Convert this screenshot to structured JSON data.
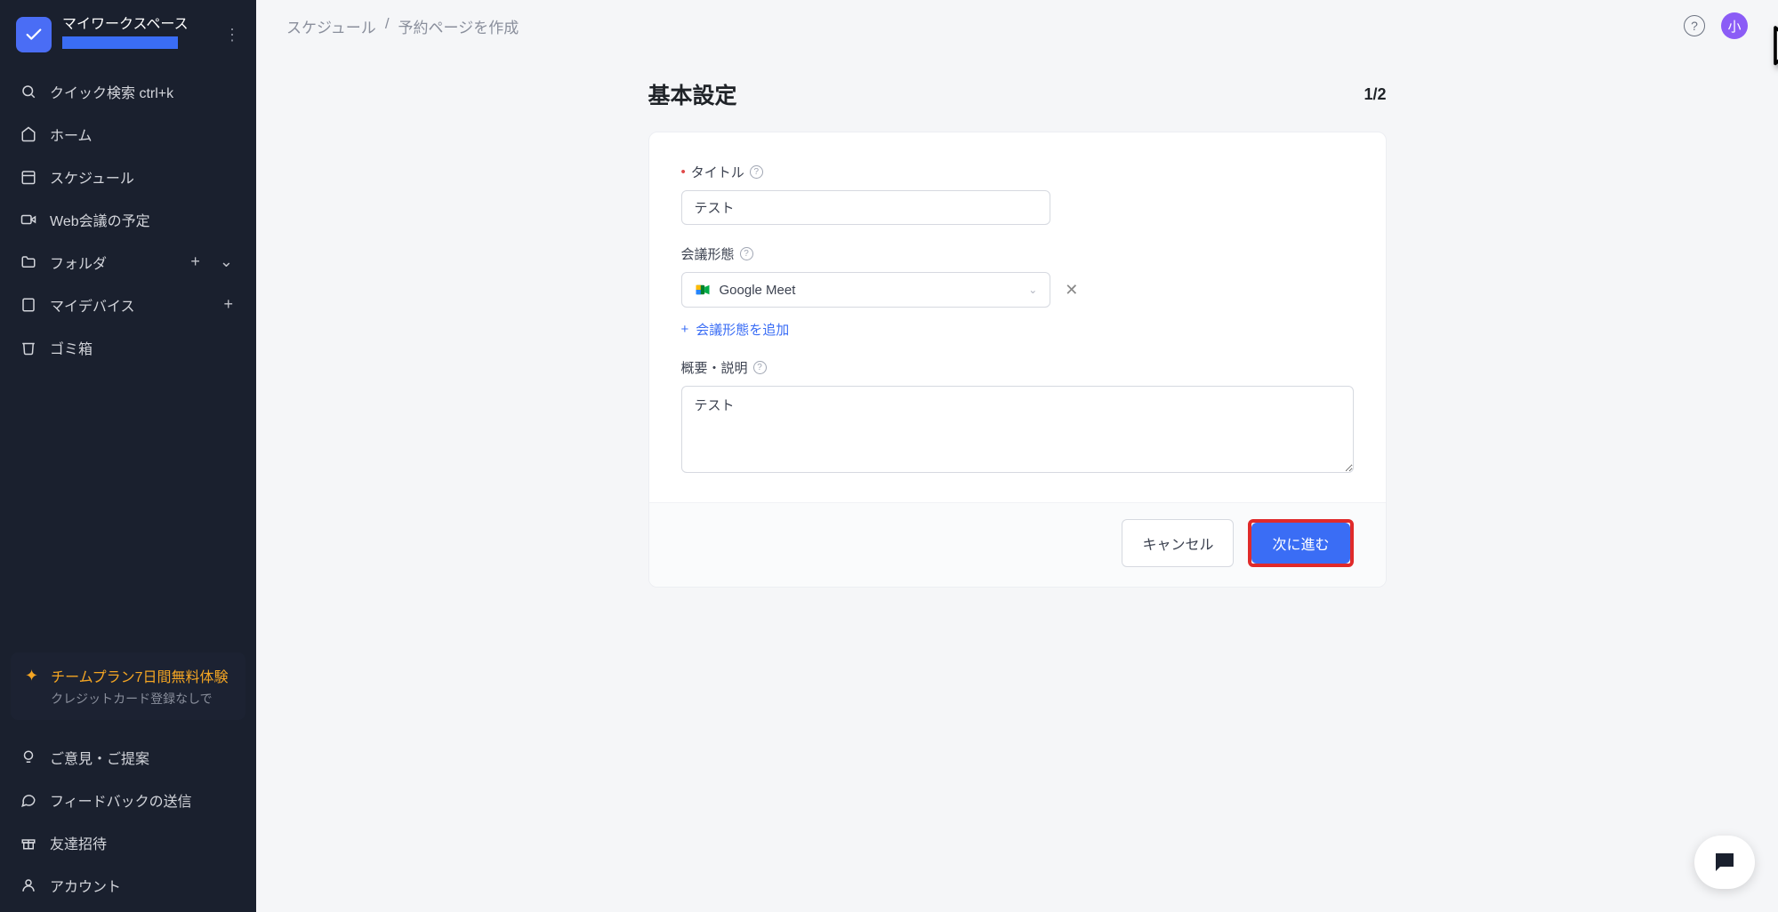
{
  "workspace": {
    "title": "マイワークスペース"
  },
  "nav": {
    "quick_search": "クイック検索 ctrl+k",
    "home": "ホーム",
    "schedule": "スケジュール",
    "web_meetings": "Web会議の予定",
    "folders": "フォルダ",
    "my_devices": "マイデバイス",
    "trash": "ゴミ箱"
  },
  "trial": {
    "title": "チームプラン7日間無料体験",
    "subtitle": "クレジットカード登録なしで"
  },
  "footer_nav": {
    "feedback": "ご意見・ご提案",
    "send_feedback": "フィードバックの送信",
    "invite": "友達招待",
    "account": "アカウント"
  },
  "breadcrumb": {
    "parent": "スケジュール",
    "sep": "/",
    "current": "予約ページを作成"
  },
  "header": {
    "help": "?",
    "avatar_initial": "小"
  },
  "page": {
    "title": "基本設定",
    "step": "1/2"
  },
  "form": {
    "title_label": "タイトル",
    "title_value": "テスト",
    "meeting_type_label": "会議形態",
    "meeting_type_value": "Google Meet",
    "add_meeting": "会議形態を追加",
    "description_label": "概要・説明",
    "description_value": "テスト"
  },
  "buttons": {
    "cancel": "キャンセル",
    "next": "次に進む"
  }
}
